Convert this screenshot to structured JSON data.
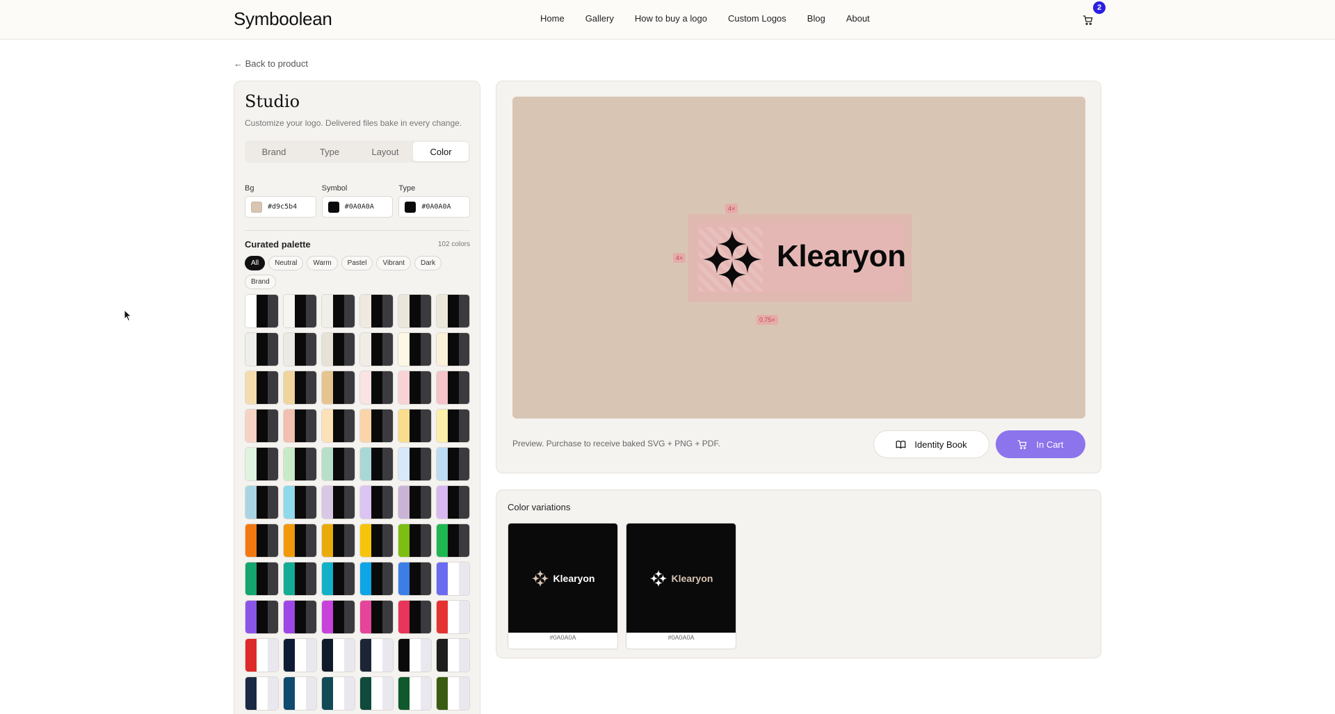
{
  "header": {
    "logo": "Symboolean",
    "nav": [
      "Home",
      "Gallery",
      "How to buy a logo",
      "Custom Logos",
      "Blog",
      "About"
    ],
    "cart_count": "2"
  },
  "back_link": "← Back to product",
  "studio": {
    "title": "Studio",
    "subtitle": "Customize your logo. Delivered files bake in every change.",
    "tabs": [
      "Brand",
      "Type",
      "Layout",
      "Color"
    ],
    "active_tab": "Color",
    "fields": [
      {
        "label": "Bg",
        "value": "#d9c5b4",
        "swatch": "#d9c5b4"
      },
      {
        "label": "Symbol",
        "value": "#0A0A0A",
        "swatch": "#0a0a0a"
      },
      {
        "label": "Type",
        "value": "#0A0A0A",
        "swatch": "#0a0a0a"
      }
    ],
    "palette_title": "Curated palette",
    "palette_count": "102 colors",
    "filters": [
      "All",
      "Neutral",
      "Warm",
      "Pastel",
      "Vibrant",
      "Dark",
      "Brand"
    ],
    "active_filter": "All",
    "swatches": [
      "#ffffff",
      "#f6f5f2",
      "#f1efea",
      "#efe9df",
      "#ebe6da",
      "#ece8d9",
      "#eeeeec",
      "#ebeae5",
      "#e6e2d8",
      "#f1ece5",
      "#fdf8e6",
      "#fbf0da",
      "#f5dcae",
      "#efd49d",
      "#e6c48f",
      "#f9e3e3",
      "#f8d3d6",
      "#f4c4c8",
      "#f6d3c5",
      "#f1c0b0",
      "#fde2b8",
      "#fbd5a9",
      "#f9dc8c",
      "#fcefa9",
      "#dff3e0",
      "#c8eac8",
      "#b7dfc9",
      "#a9d7d6",
      "#d7e8fa",
      "#bcdcf4",
      "#a9d5e3",
      "#8fd9ea",
      "#d9c7e6",
      "#dcc4f2",
      "#cab4d6",
      "#d7b8f1",
      "#f2780f",
      "#f1990b",
      "#eaab0a",
      "#f6c40a",
      "#7cbf12",
      "#1fb752",
      "#15a56f",
      "#14ac94",
      "#12b1c9",
      "#0ea5e6",
      "#3b7fe6",
      "#6a6cf0",
      "#8b56e8",
      "#9d47e6",
      "#c743dc",
      "#e6449a",
      "#e83559",
      "#e53232",
      "#dd2a2a",
      "#0e1b34",
      "#0f1a2b",
      "#1b2536",
      "#0a0a0a",
      "#1e1e1e",
      "#1a2a44",
      "#0f4a6f",
      "#124a55",
      "#0f4a3c",
      "#0f5a2c",
      "#3a5c12"
    ]
  },
  "preview": {
    "bg": "#d9c5b4",
    "symbol_color": "#0A0A0A",
    "type_color": "#0A0A0A",
    "wordmark": "Klearyon",
    "tag_top": "4×",
    "tag_left": "4×",
    "tag_bottom": "0.75×",
    "note": "Preview. Purchase to receive baked SVG + PNG + PDF.",
    "identity_book": "Identity Book",
    "in_cart": "In Cart"
  },
  "variations": {
    "title": "Color variations",
    "items": [
      {
        "wordmark": "Klearyon",
        "hex": "#0A0A0A",
        "bg": "#0a0a0a",
        "symbol": "#d9c5b4",
        "text": "#ffffff"
      },
      {
        "wordmark": "Klearyon",
        "hex": "#0A0A0A",
        "bg": "#0a0a0a",
        "symbol": "#ffffff",
        "text": "#d9c5b4"
      }
    ]
  }
}
